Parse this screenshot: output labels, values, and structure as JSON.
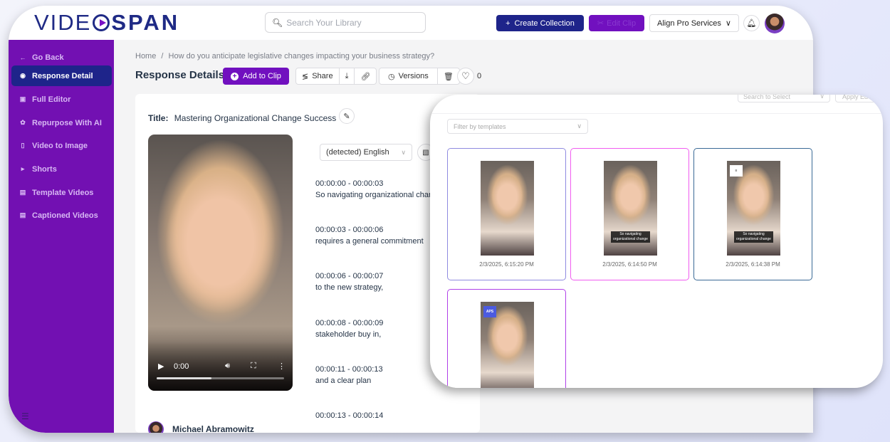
{
  "app": {
    "logo": {
      "part1": "VIDE",
      "part2": "SPAN",
      "icon": "play-circle-icon"
    },
    "search": {
      "placeholder": "Search Your Library",
      "icon": "search-icon"
    },
    "create_collection_label": "Create Collection",
    "edit_clip_label": "Edit Clip",
    "organization": "Align Pro Services",
    "colors": {
      "brand_navy": "#1e248a",
      "brand_purple": "#7110bf",
      "sidebar": "#7210b2"
    }
  },
  "sidebar": {
    "items": [
      {
        "label": "Go Back",
        "icon": "arrow-left-icon",
        "active": false
      },
      {
        "label": "Response Detail",
        "icon": "eye-icon",
        "active": true
      },
      {
        "label": "Full Editor",
        "icon": "editor-icon",
        "active": false
      },
      {
        "label": "Repurpose With AI",
        "icon": "ai-icon",
        "active": false
      },
      {
        "label": "Video to Image",
        "icon": "image-file-icon",
        "active": false
      },
      {
        "label": "Shorts",
        "icon": "play-square-icon",
        "active": false
      },
      {
        "label": "Template Videos",
        "icon": "document-icon",
        "active": false
      },
      {
        "label": "Captioned Videos",
        "icon": "document-icon",
        "active": false
      }
    ]
  },
  "main": {
    "breadcrumb": {
      "home": "Home",
      "separator": "/",
      "current": "How do you anticipate legislative changes impacting your business strategy?"
    },
    "page_title": "Response Details",
    "toolbar": {
      "add_to_clip": "Add to Clip",
      "share": "Share",
      "versions": "Versions",
      "likes": "0"
    },
    "title_label": "Title:",
    "title_value": "Mastering Organizational Change Success",
    "video": {
      "time": "0:00",
      "progress_percent": 43
    },
    "language": "(detected) English",
    "transcript": [
      {
        "range": "00:00:00 - 00:00:03",
        "text": "So navigating organizational change"
      },
      {
        "range": "00:00:03 - 00:00:06",
        "text": "requires a general commitment"
      },
      {
        "range": "00:00:06 - 00:00:07",
        "text": "to the new strategy,"
      },
      {
        "range": "00:00:08 - 00:00:09",
        "text": "stakeholder buy in,"
      },
      {
        "range": "00:00:11 - 00:00:13",
        "text": "and a clear plan"
      },
      {
        "range": "00:00:13 - 00:00:14",
        "text": ""
      }
    ],
    "speaker": "Michael Abramowitz"
  },
  "overlay": {
    "search_placeholder": "Search to Select",
    "apply_label": "Apply Ed",
    "filter_placeholder": "Filter by templates",
    "tiles": [
      {
        "date": "2/3/2025, 6:15:20 PM",
        "caption": "",
        "badge": "",
        "border": "#8f8ae0"
      },
      {
        "date": "2/3/2025, 6:14:50 PM",
        "caption": "So navigating organizational change",
        "badge": "",
        "border": "#f05cf0"
      },
      {
        "date": "2/3/2025, 6:14:38 PM",
        "caption": "So navigating organizational change",
        "badge": "logo",
        "border": "#3a6a96"
      },
      {
        "date": "",
        "caption": "",
        "badge": "APS",
        "border": "#b040e8"
      }
    ]
  }
}
